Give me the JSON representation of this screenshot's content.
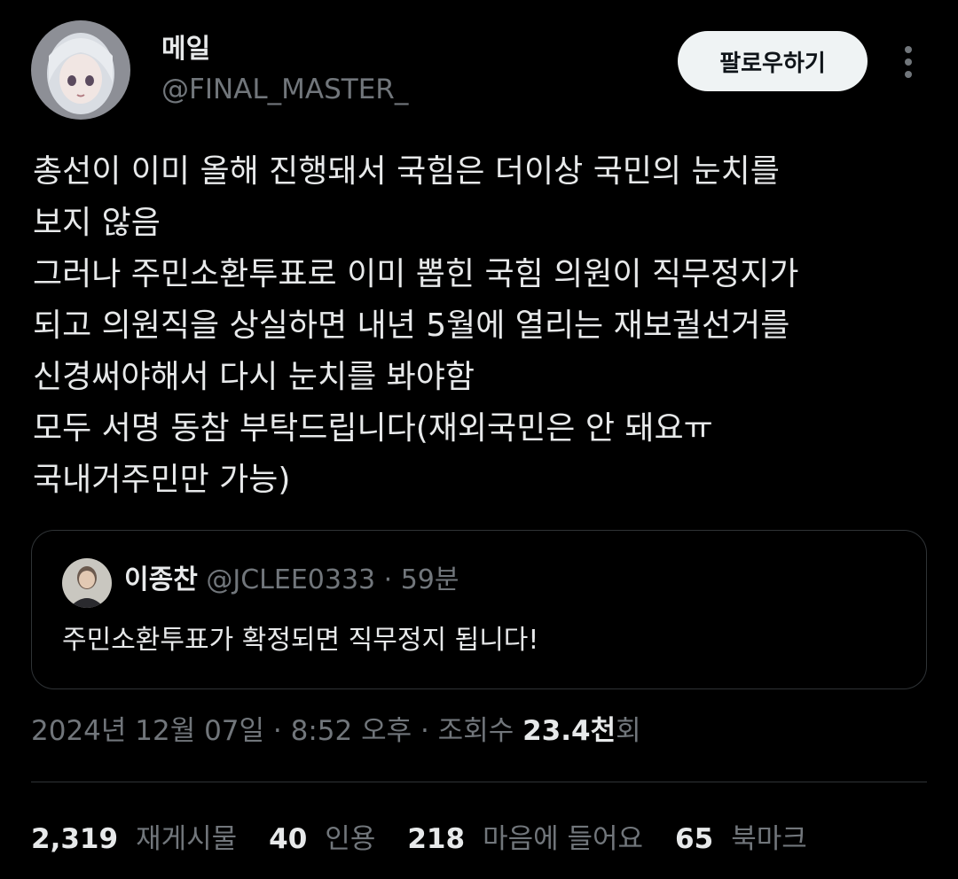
{
  "author": {
    "display_name": "메일",
    "handle": "@FINAL_MASTER_",
    "avatar_icon": "anime-avatar-icon"
  },
  "header": {
    "follow_label": "팔로우하기",
    "more_icon": "more-vertical-icon"
  },
  "tweet": {
    "text": "총선이 이미 올해 진행돼서 국힘은 더이상 국민의 눈치를\n보지 않음\n그러나 주민소환투표로 이미 뽑힌 국힘 의원이 직무정지가\n되고 의원직을 상실하면 내년 5월에 열리는 재보궐선거를\n신경써야해서 다시 눈치를 봐야함\n모두 서명 동참 부탁드립니다(재외국민은 안 돼요ㅠ\n국내거주민만 가능)"
  },
  "quote": {
    "name": "이종찬",
    "meta": " @JCLEE0333 · 59분",
    "text": "주민소환투표가 확정되면 직무정지 됩니다!",
    "avatar_icon": "user-avatar-icon"
  },
  "timestamp": {
    "text": "2024년 12월 07일 · 8:52 오후 · 조회수 ",
    "views": "23.4천",
    "views_suffix": "회"
  },
  "stats": {
    "reposts_count": "2,319",
    "reposts_label": "재게시물",
    "quotes_count": "40",
    "quotes_label": "인용",
    "likes_count": "218",
    "likes_label": "마음에 들어요",
    "bookmarks_count": "65",
    "bookmarks_label": "북마크"
  }
}
